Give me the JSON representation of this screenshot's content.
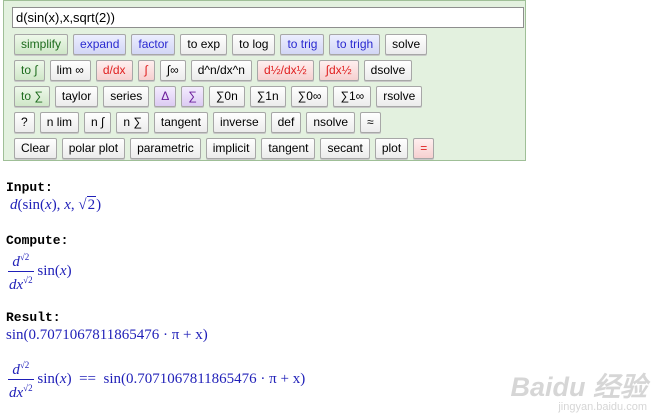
{
  "input": {
    "value": "d(sin(x),x,sqrt(2))"
  },
  "buttons": {
    "row1": [
      "simplify",
      "expand",
      "factor",
      "to exp",
      "to log",
      "to trig",
      "to trigh",
      "solve"
    ],
    "row2": [
      "to ∫",
      "lim ∞",
      "d/dx",
      "∫",
      "∫∞",
      "d^n/dx^n",
      "d½/dx½",
      "∫dx½",
      "dsolve"
    ],
    "row3": [
      "to ∑",
      "taylor",
      "series",
      "Δ",
      "∑",
      "∑0n",
      "∑1n",
      "∑0∞",
      "∑1∞",
      "rsolve"
    ],
    "row4": [
      "?",
      "n lim",
      "n ∫",
      "n ∑",
      "tangent",
      "inverse",
      "def",
      "nsolve",
      "≈"
    ],
    "row5": [
      "Clear",
      "polar plot",
      "parametric",
      "implicit",
      "tangent",
      "secant",
      "plot",
      "="
    ]
  },
  "output": {
    "input_label": "Input:",
    "compute_label": "Compute:",
    "result_label": "Result:",
    "input_expr": {
      "d": "d",
      "sin": "sin",
      "x": "x",
      "sqrt_arg": "2"
    },
    "compute_expr": {
      "num_d": "d",
      "den_dx": "dx",
      "sup": "√2",
      "func": "sin",
      "x": "x"
    },
    "result_expr": "sin(0.7071067811865476 · π + x)",
    "equality_expr": {
      "num_d": "d",
      "den_dx": "dx",
      "sup": "√2",
      "func": "sin",
      "x": "x",
      "eq": "==",
      "rhs": "sin(0.7071067811865476 · π + x)"
    }
  },
  "watermark": {
    "main": "Baidu 经验",
    "sub": "jingyan.baidu.com"
  }
}
